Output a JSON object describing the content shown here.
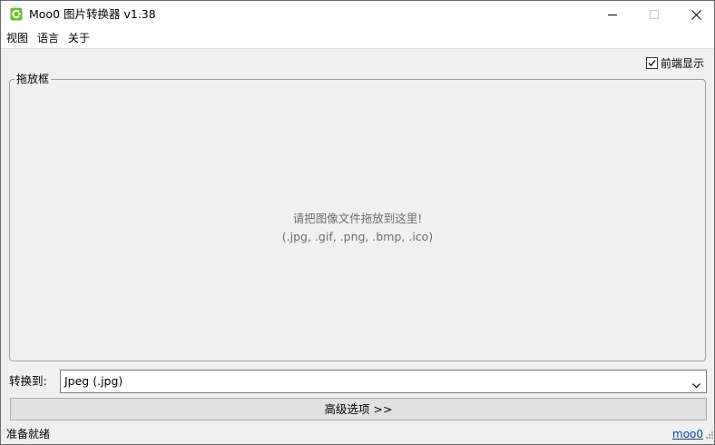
{
  "window": {
    "title": "Moo0 图片转换器 v1.38",
    "icon": "moo0-logo-icon"
  },
  "window_controls": {
    "minimize": "minimize-icon",
    "maximize": "maximize-icon",
    "close": "close-icon"
  },
  "menu": {
    "items": [
      "视图",
      "语言",
      "关于"
    ]
  },
  "topmost": {
    "label": "前端显示",
    "checked": true
  },
  "dropzone": {
    "legend": "拖放框",
    "hint_line1": "请把图像文件拖放到这里!",
    "hint_line2": "(.jpg, .gif, .png, .bmp, .ico)"
  },
  "convert": {
    "label": "转换到:",
    "selected": "Jpeg (.jpg)"
  },
  "advanced": {
    "label": "高级选项 >>"
  },
  "status": {
    "text": "准备就绪",
    "link": "moo0"
  },
  "colors": {
    "link": "#0b3fa8",
    "hint_text": "#6d6d6d",
    "icon_green": "#6dbf2e"
  }
}
